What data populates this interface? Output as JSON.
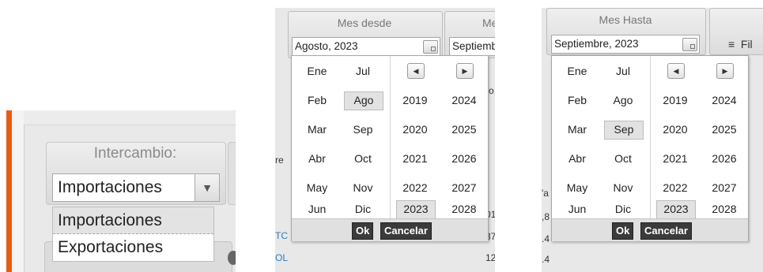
{
  "panel1": {
    "header": "Intercambio:",
    "selected": "Importaciones",
    "options": [
      "Importaciones",
      "Exportaciones"
    ]
  },
  "panel2": {
    "header": "Mes desde",
    "next_header": "Me",
    "input_value": "Agosto, 2023",
    "next_input": "Septiembr",
    "peek": {
      "left_1": "re",
      "right_1": "o",
      "right_2": "01",
      "right_3": "37",
      "right_4": "12",
      "left_2": "TC",
      "left_3": "OL"
    }
  },
  "panel3": {
    "header": "Mes Hasta",
    "input_value": "Septiembre, 2023",
    "filter_label": "Fil",
    "peek": {
      "left_1": "'a",
      "left_2": ",8",
      "left_3": ".4",
      "left_4": ".4"
    }
  },
  "picker": {
    "months_col1": [
      "Ene",
      "Feb",
      "Mar",
      "Abr",
      "May",
      "Jun"
    ],
    "months_col2": [
      "Jul",
      "Ago",
      "Sep",
      "Oct",
      "Nov",
      "Dic"
    ],
    "years_col1": [
      "2019",
      "2020",
      "2021",
      "2022",
      "2023"
    ],
    "years_col2": [
      "2024",
      "2025",
      "2026",
      "2027",
      "2028"
    ],
    "prev_icon": "caret-left-icon",
    "next_icon": "caret-right-icon",
    "ok_label": "Ok",
    "cancel_label": "Cancelar"
  },
  "colors": {
    "accent_orange": "#e85d16",
    "link_blue": "#2a7fc1"
  }
}
